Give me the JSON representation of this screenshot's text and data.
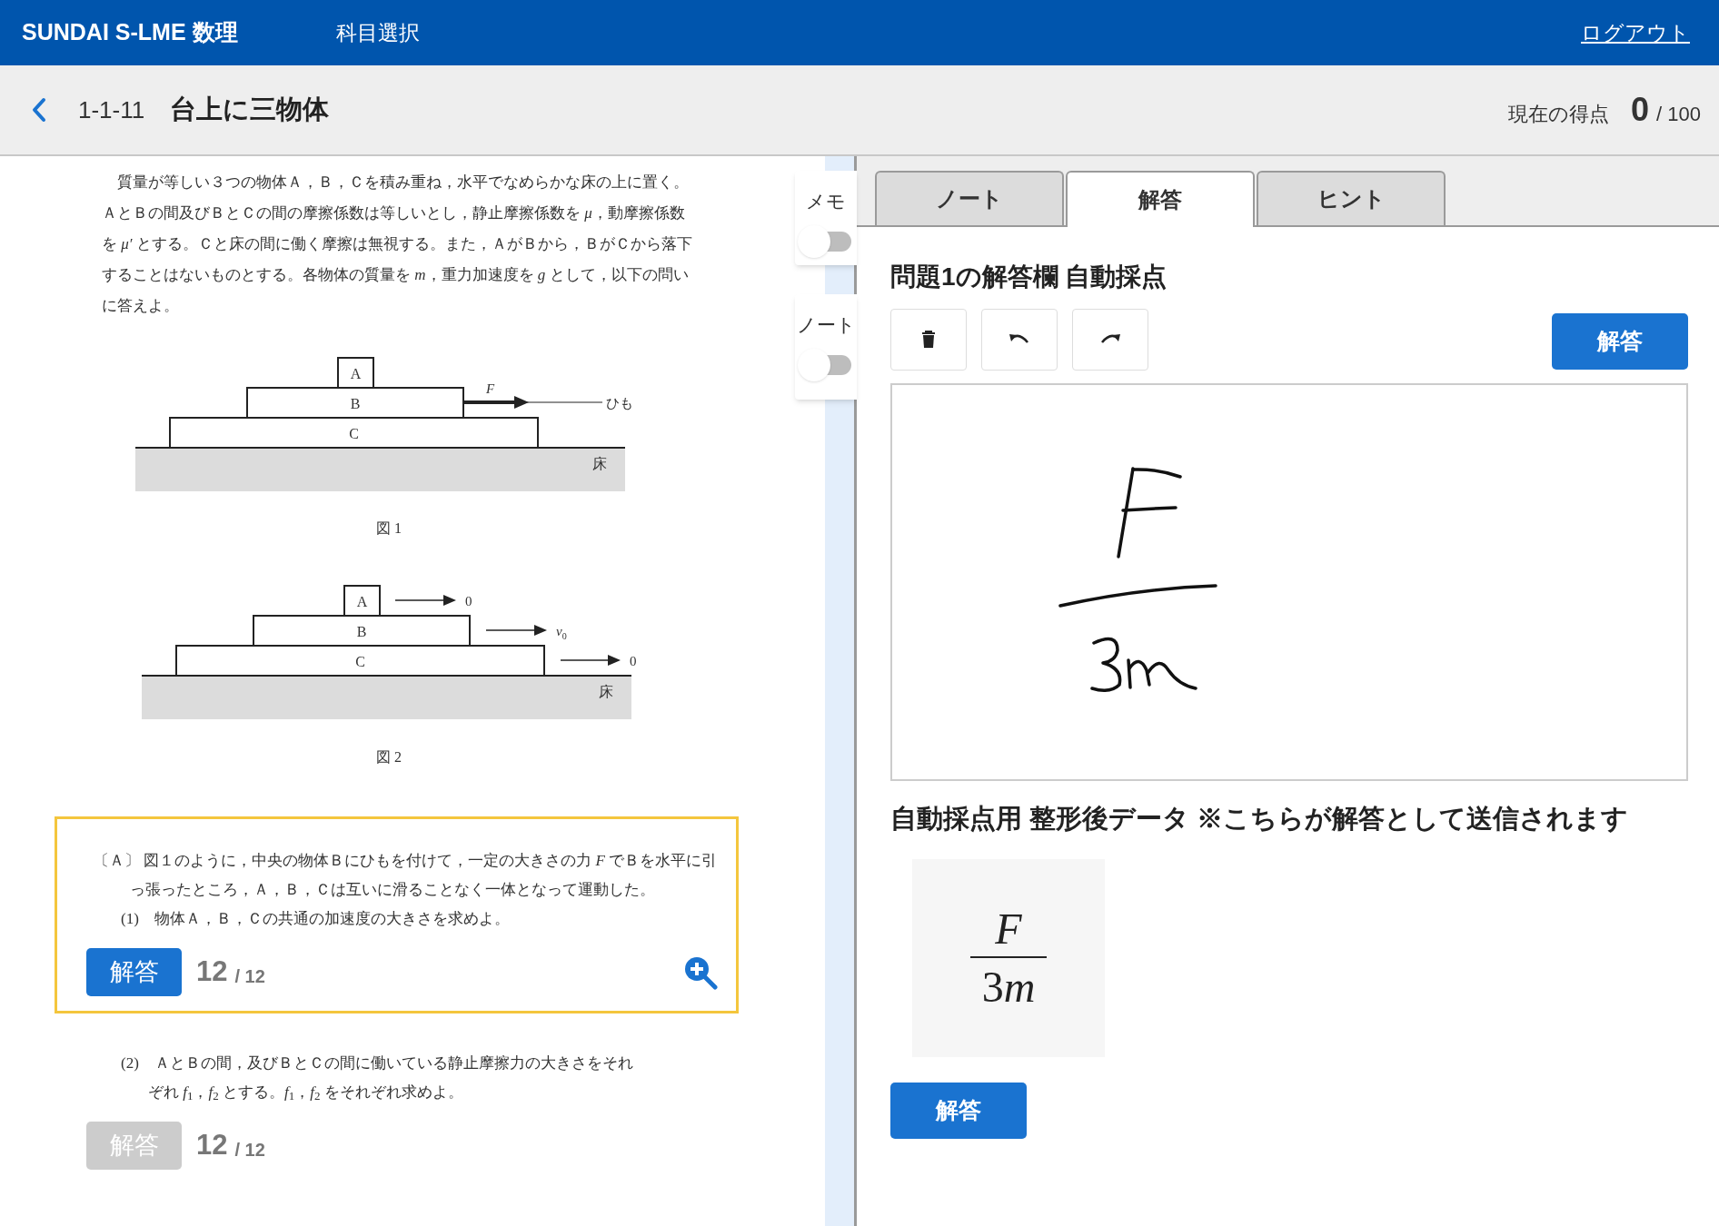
{
  "header": {
    "title": "SUNDAI S-LME 数理",
    "nav": "科目選択",
    "logout": "ログアウト"
  },
  "subheader": {
    "code": "1-1-11",
    "title": "台上に三物体",
    "score_label": "現在の得点",
    "score": "0",
    "score_total": "/ 100"
  },
  "problem": {
    "intro": "質量が等しい３つの物体Ａ，Ｂ，Ｃを積み重ね，水平でなめらかな床の上に置く。ＡとＢの間及びＢとＣの間の摩擦係数は等しいとし，静止摩擦係数を *μ*，動摩擦係数を *μ′* とする。Ｃと床の間に働く摩擦は無視する。また，ＡがＢから，ＢがＣから落下することはないものとする。各物体の質量を *m*，重力加速度を *g* として，以下の問いに答えよ。",
    "figures": [
      {
        "kind": "pull",
        "blocks": [
          "A",
          "B",
          "C"
        ],
        "force": "F",
        "string": "ひも",
        "floor": "床",
        "caption": "図 1"
      },
      {
        "kind": "velocities",
        "blocks": [
          "A",
          "B",
          "C"
        ],
        "arrows": [
          "0",
          "*v*$_{0}$",
          "0"
        ],
        "floor": "床",
        "caption": "図 2"
      }
    ]
  },
  "questions": [
    {
      "selected": true,
      "paragraphs": [
        "〔Ａ〕 図１のように，中央の物体Ｂにひもを付けて，一定の大きさの力 *F* でＢを水平に引っ張ったところ，Ａ，Ｂ，Ｃは互いに滑ることなく一体となって運動した。",
        "(1)　物体Ａ，Ｂ，Ｃの共通の加速度の大きさを求めよ。"
      ],
      "button": "解答",
      "disabled": false,
      "score": "12",
      "total": "/ 12"
    },
    {
      "selected": false,
      "paragraphs": [
        "(2)　ＡとＢの間，及びＢとＣの間に働いている静止摩擦力の大きさをそれぞれ *f*$_{1}$，*f*$_{2}$ とする。*f*$_{1}$，*f*$_{2}$ をそれぞれ求めよ。"
      ],
      "button": "解答",
      "disabled": true,
      "score": "12",
      "total": "/ 12"
    }
  ],
  "toggles": [
    {
      "label": "メモ",
      "on": false
    },
    {
      "label": "ノート",
      "on": false
    }
  ],
  "tabs": [
    {
      "label": "ノート",
      "selected": false
    },
    {
      "label": "解答",
      "selected": true
    },
    {
      "label": "ヒント",
      "selected": false
    }
  ],
  "answer": {
    "heading": "問題1の解答欄 自動採点",
    "submit": "解答",
    "result_heading": "自動採点用 整形後データ ",
    "result_note": "※こちらが解答として送信されます",
    "numerator": "F",
    "denominator_coefficient": "3",
    "denominator_variable": "m",
    "bottom_button": "解答"
  }
}
